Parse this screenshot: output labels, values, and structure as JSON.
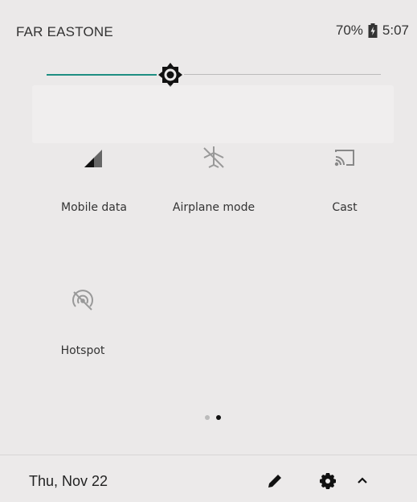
{
  "status_bar": {
    "carrier": "FAR EASTONE",
    "battery_percent": "70%",
    "time": "5:07",
    "battery_icon": "battery-charging-icon"
  },
  "brightness": {
    "level": 0.37,
    "accent_color": "#1e8e82",
    "icon": "brightness-icon"
  },
  "tiles": [
    {
      "label": "Mobile data",
      "icon": "cellular-signal-icon"
    },
    {
      "label": "Airplane mode",
      "icon": "airplane-off-icon"
    },
    {
      "label": "Cast",
      "icon": "cast-icon"
    },
    {
      "label": "Hotspot",
      "icon": "hotspot-off-icon"
    }
  ],
  "pager": {
    "pages": 2,
    "current": 2
  },
  "footer": {
    "date": "Thu, Nov 22",
    "edit_icon": "pencil-icon",
    "settings_icon": "gear-icon",
    "collapse_icon": "chevron-up-icon"
  }
}
